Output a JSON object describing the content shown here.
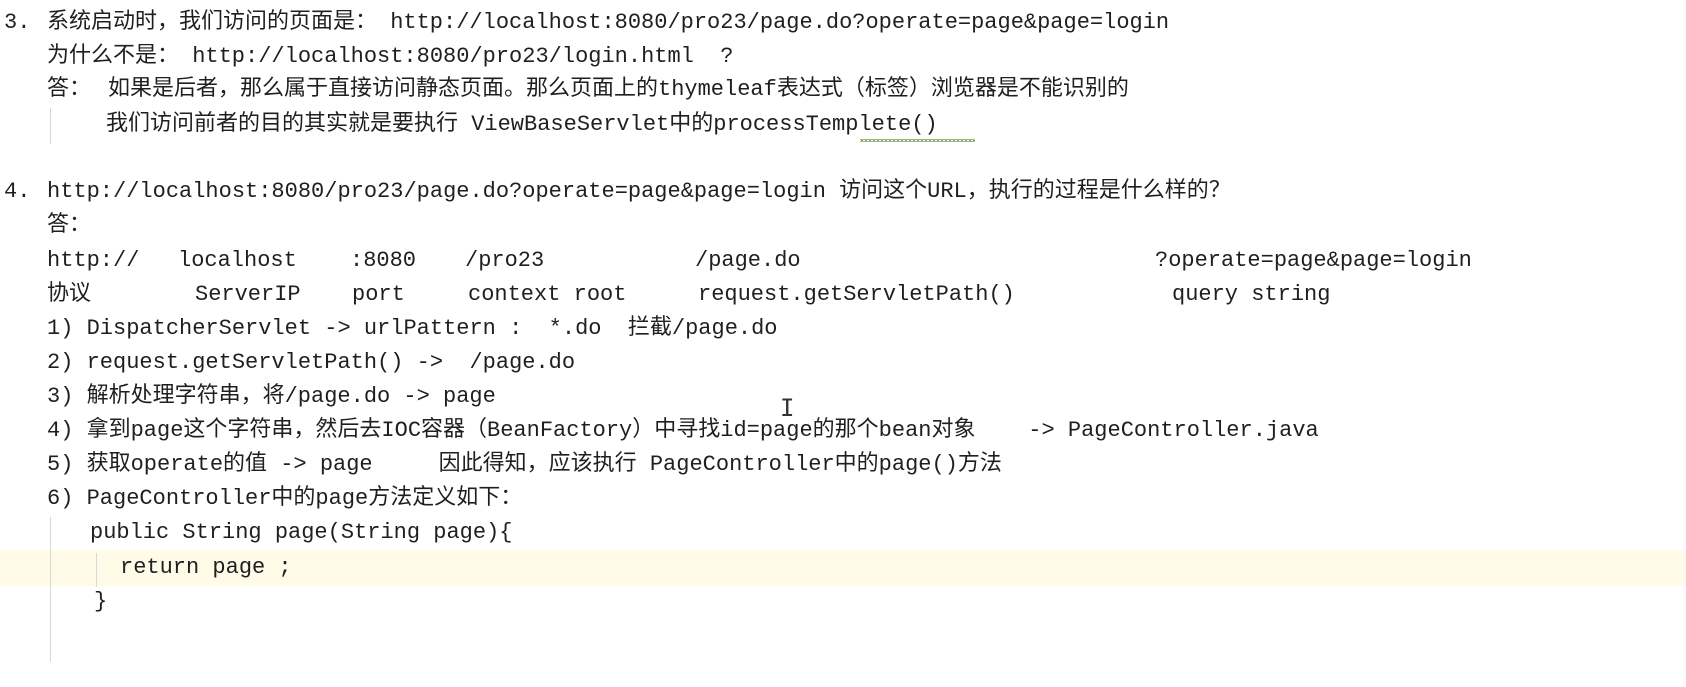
{
  "doc": {
    "s3": {
      "l1_num": "3.",
      "l1_text": "系统启动时，我们访问的页面是： http://localhost:8080/pro23/page.do?operate=page&page=login",
      "l2": "为什么不是： http://localhost:8080/pro23/login.html  ?",
      "l3_label": "答：",
      "l3_text": "如果是后者，那么属于直接访问静态页面。那么页面上的thymeleaf表达式（标签）浏览器是不能识别的",
      "l4_text": "我们访问前者的目的其实就是要执行 ViewBaseServlet中的processTemplete()"
    },
    "s4": {
      "l1_num": "4.",
      "l1_text": "http://localhost:8080/pro23/page.do?operate=page&page=login 访问这个URL，执行的过程是什么样的？",
      "l2": "答：",
      "url_parts": {
        "protocol": "http://",
        "server": "localhost",
        "port": ":8080",
        "context": "/pro23",
        "servlet": "/page.do",
        "query": "?operate=page&page=login"
      },
      "url_labels": {
        "protocol": "协议",
        "server": "ServerIP",
        "port": "port",
        "context": "context root",
        "servlet": "request.getServletPath()",
        "query": "query string"
      },
      "steps": [
        "1) DispatcherServlet -> urlPattern :  *.do  拦截/page.do",
        "2) request.getServletPath() ->  /page.do",
        "3) 解析处理字符串，将/page.do -> page",
        "4) 拿到page这个字符串，然后去IOC容器（BeanFactory）中寻找id=page的那个bean对象    -> PageController.java",
        "5) 获取operate的值 -> page     因此得知，应该执行 PageController中的page()方法",
        "6) PageController中的page方法定义如下："
      ],
      "code": [
        "public String page(String page){",
        "return page ;",
        "}"
      ]
    }
  },
  "colors": {
    "text": "#1f1f1f",
    "line_highlight": "#fffbe8",
    "indent_guide": "#d8d8d8",
    "spell_squiggle": "#7aa35f"
  },
  "cursor_icon": "text-cursor-ibeam"
}
